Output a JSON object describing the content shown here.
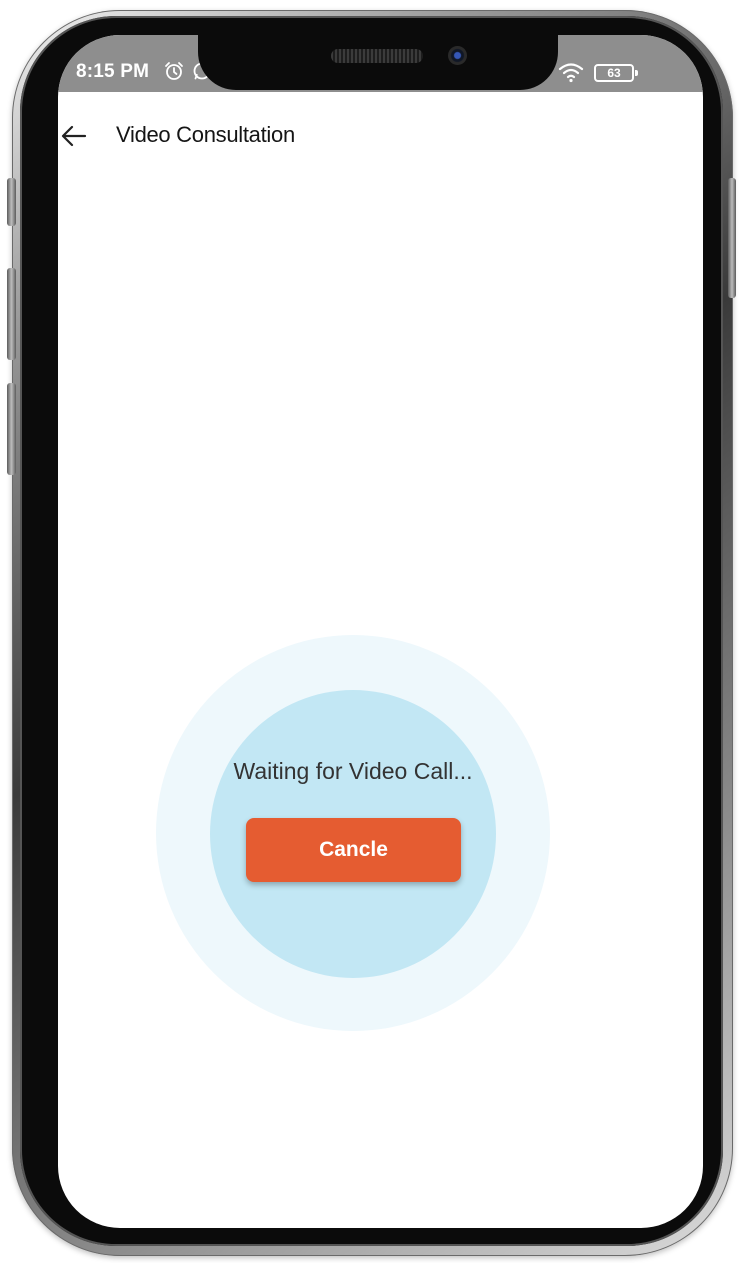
{
  "status_bar": {
    "time": "8:15 PM",
    "battery": "63",
    "icons": [
      "alarm-icon",
      "whatsapp-icon",
      "wifi-icon",
      "battery-icon"
    ],
    "background_color": "#8e8e8e"
  },
  "app_bar": {
    "back_icon": "arrow-left-icon",
    "title": "Video Consultation"
  },
  "main": {
    "waiting_text": "Waiting for Video Call...",
    "cancel_label": "Cancle"
  },
  "colors": {
    "accent": "#e55c31",
    "inner_circle": "#c2e7f4",
    "outer_circle": "#eef8fc"
  }
}
